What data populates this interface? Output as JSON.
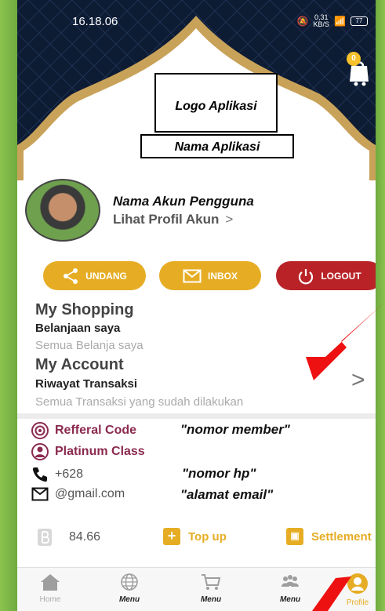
{
  "status_bar": {
    "time": "16.18.06",
    "speed_value": "0,31",
    "speed_unit": "KB/S",
    "battery": "77"
  },
  "header": {
    "cart_count": "0",
    "logo_text": "Logo Aplikasi",
    "app_name": "Nama Aplikasi"
  },
  "account": {
    "name": "Nama Akun Pengguna",
    "profile_link": "Lihat Profil Akun",
    "profile_chevron": ">"
  },
  "actions": {
    "invite_label": "UNDANG",
    "inbox_label": "INBOX",
    "logout_label": "LOGOUT"
  },
  "sections": {
    "shopping_title": "My Shopping",
    "shopping_sub": "Belanjaan saya",
    "shopping_desc": "Semua Belanja saya",
    "account_title": "My Account",
    "account_sub": "Riwayat Transaksi",
    "account_desc": "Semua Transaksi yang sudah dilakukan",
    "chevron": ">"
  },
  "info": {
    "referral_label": "Refferal Code",
    "referral_note": "\"nomor member\"",
    "class_label": "Platinum Class",
    "phone_value": "+628",
    "phone_note": "\"nomor hp\"",
    "email_value": "@gmail.com",
    "email_note": "\"alamat email\""
  },
  "wallet": {
    "balance": "84.66",
    "topup_label": "Top up",
    "settlement_label": "Settlement"
  },
  "nav": {
    "home": "Home",
    "menu1": "Menu",
    "menu2": "Menu",
    "menu3": "Menu",
    "profile": "Profile"
  },
  "colors": {
    "gold": "#e6ad24",
    "logout_red": "#b92327",
    "maroon": "#8b2a4f",
    "header_navy": "#0d1b33",
    "side_green": "#7db84a",
    "arrow_red": "#ee1111"
  }
}
